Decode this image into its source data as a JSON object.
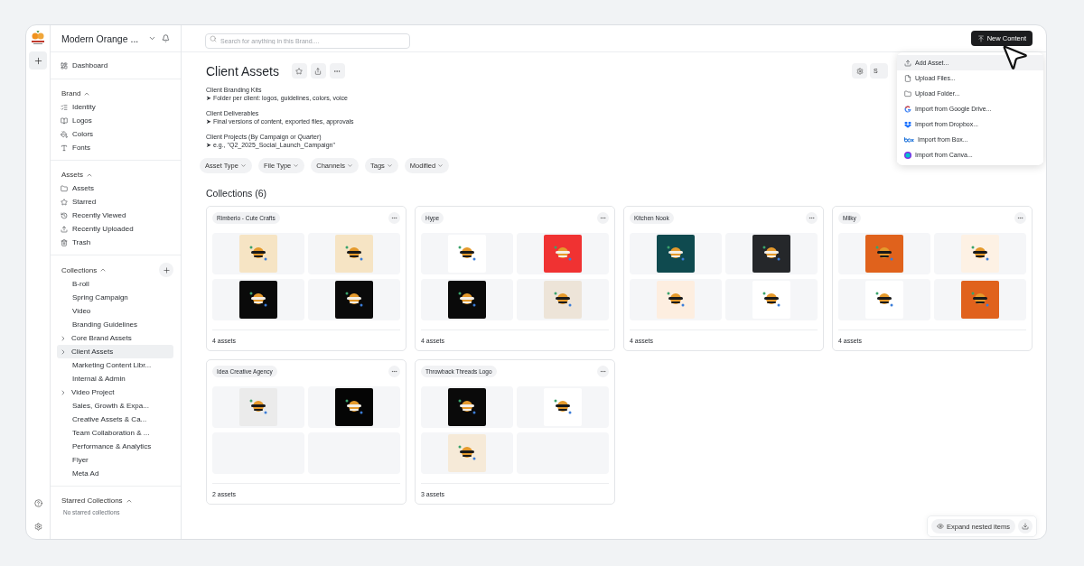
{
  "rail": {
    "logo": {
      "kind": "picture"
    }
  },
  "sidebar": {
    "brand_name": "Modern Orange ...",
    "dashboard": "Dashboard",
    "sections": [
      {
        "title": "Brand",
        "expanded": true,
        "items": [
          {
            "label": "Identity"
          },
          {
            "label": "Logos"
          },
          {
            "label": "Colors"
          },
          {
            "label": "Fonts"
          }
        ]
      },
      {
        "title": "Assets",
        "expanded": true,
        "items": [
          {
            "label": "Assets"
          },
          {
            "label": "Starred"
          },
          {
            "label": "Recently Viewed"
          },
          {
            "label": "Recently Uploaded"
          },
          {
            "label": "Trash"
          }
        ]
      }
    ],
    "collections": {
      "title": "Collections",
      "expanded": true,
      "items": [
        {
          "label": "B-roll",
          "has_children": false,
          "selected": false
        },
        {
          "label": "Spring Campaign",
          "has_children": false,
          "selected": false
        },
        {
          "label": "Video",
          "has_children": false,
          "selected": false
        },
        {
          "label": "Branding Guidelines",
          "has_children": false,
          "selected": false
        },
        {
          "label": "Core Brand Assets",
          "has_children": true,
          "selected": false
        },
        {
          "label": "Client Assets",
          "has_children": true,
          "selected": true
        },
        {
          "label": "Marketing Content Libr...",
          "has_children": false,
          "selected": false
        },
        {
          "label": "Internal & Admin",
          "has_children": false,
          "selected": false
        },
        {
          "label": "Video Project",
          "has_children": true,
          "selected": false
        },
        {
          "label": "Sales, Growth & Expa...",
          "has_children": false,
          "selected": false
        },
        {
          "label": "Creative Assets & Ca...",
          "has_children": false,
          "selected": false
        },
        {
          "label": "Team Collaboration & ...",
          "has_children": false,
          "selected": false
        },
        {
          "label": "Performance & Analytics",
          "has_children": false,
          "selected": false
        },
        {
          "label": "Flyer",
          "has_children": false,
          "selected": false
        },
        {
          "label": "Meta Ad",
          "has_children": false,
          "selected": false
        }
      ]
    },
    "starred": {
      "title": "Starred Collections",
      "expanded": true,
      "empty_text": "No starred collections"
    }
  },
  "topbar": {
    "search": {
      "placeholder": "Search for anything in this Brand...."
    },
    "new_content": "New Content"
  },
  "header": {
    "title": "Client Assets",
    "side_button": "S"
  },
  "description": [
    {
      "heading": "Client Branding Kits",
      "detail": "➤ Folder per client: logos, guidelines, colors, voice"
    },
    {
      "heading": "Client Deliverables",
      "detail": "➤ Final versions of content, exported files, approvals"
    },
    {
      "heading": "Client Projects (By Campaign or Quarter)",
      "detail": "➤ e.g., \"Q2_2025_Social_Launch_Campaign\""
    }
  ],
  "filters": [
    "Asset Type",
    "File Type",
    "Channels",
    "Tags",
    "Modified"
  ],
  "collections": {
    "title": "Collections (6)",
    "items": [
      {
        "name": "Rimberio - Cute Crafts",
        "count": "4 assets",
        "thumbnails": [
          {
            "color": "#f6e4c4"
          },
          {
            "color": "#f6e4c4"
          },
          {
            "color": "#0a0a0a"
          },
          {
            "color": "#0a0a0a"
          }
        ]
      },
      {
        "name": "Hype",
        "count": "4 assets",
        "thumbnails": [
          {
            "color": "#ffffff"
          },
          {
            "color": "#f03232"
          },
          {
            "color": "#0a0a0a"
          },
          {
            "color": "#ede4d8"
          }
        ]
      },
      {
        "name": "Kitchen Nook",
        "count": "4 assets",
        "thumbnails": [
          {
            "color": "#0f4a4f"
          },
          {
            "color": "#25272a"
          },
          {
            "color": "#fdeee0"
          },
          {
            "color": "#ffffff"
          }
        ]
      },
      {
        "name": "Milky",
        "count": "4 assets",
        "thumbnails": [
          {
            "color": "#e0621c"
          },
          {
            "color": "#fdf1e4"
          },
          {
            "color": "#ffffff"
          },
          {
            "color": "#e0621c"
          }
        ]
      },
      {
        "name": "Idea Creative Agency",
        "count": "2 assets",
        "thumbnails": [
          {
            "color": "#ebebeb"
          },
          {
            "color": "#050505"
          }
        ]
      },
      {
        "name": "Throwback Threads Logo",
        "count": "3 assets",
        "thumbnails": [
          {
            "color": "#0a0a0a"
          },
          {
            "color": "#ffffff"
          },
          {
            "color": "#f6ead8"
          }
        ]
      }
    ]
  },
  "menu": [
    {
      "label": "Add Asset...",
      "selected": true
    },
    {
      "label": "Upload Files...",
      "selected": false
    },
    {
      "label": "Upload Folder...",
      "selected": false
    },
    {
      "label": "Import from Google Drive...",
      "selected": false
    },
    {
      "label": "Import from Dropbox...",
      "selected": false
    },
    {
      "label": "Import from Box...",
      "selected": false
    },
    {
      "label": "Import from Canva...",
      "selected": false
    }
  ],
  "footer": {
    "expand": "Expand nested items"
  }
}
